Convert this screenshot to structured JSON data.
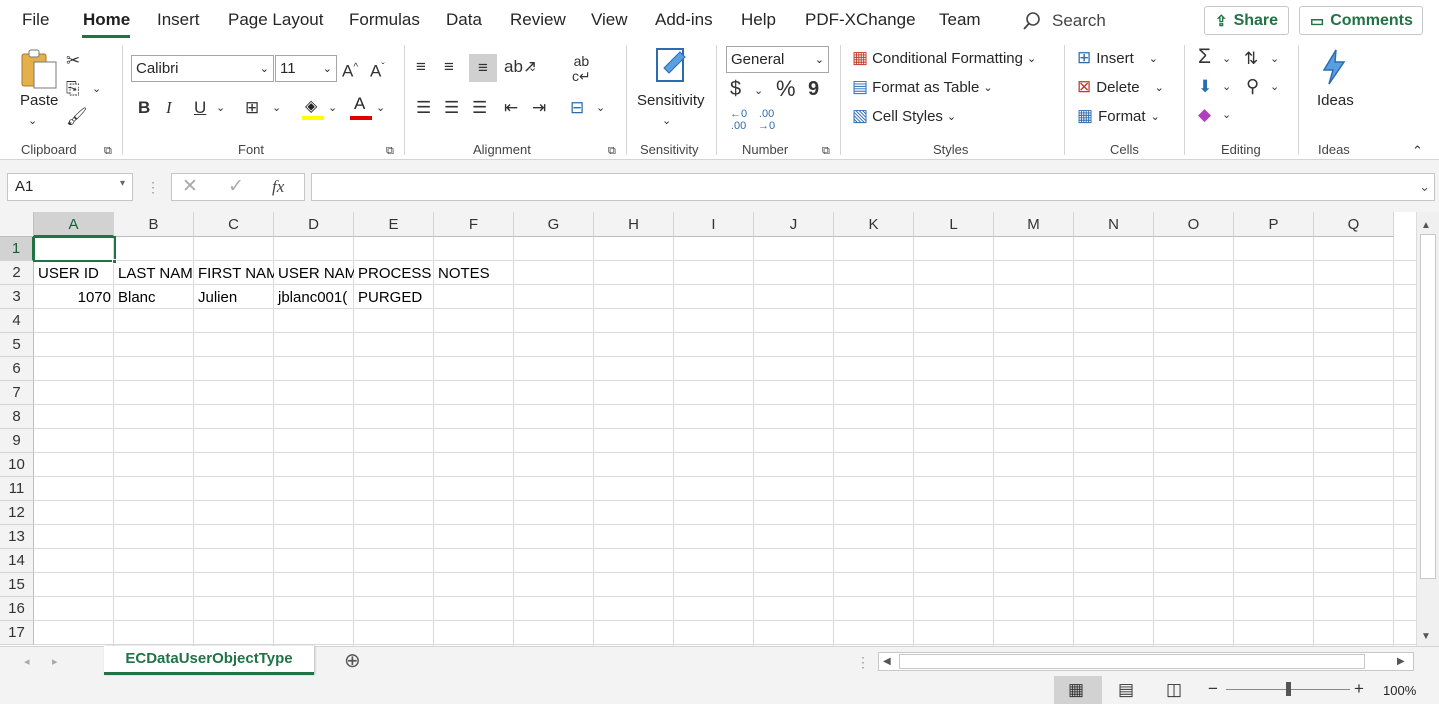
{
  "menu": {
    "tabs": [
      "File",
      "Home",
      "Insert",
      "Page Layout",
      "Formulas",
      "Data",
      "Review",
      "View",
      "Add-ins",
      "Help",
      "PDF-XChange",
      "Team"
    ],
    "search": "Search",
    "share": "Share",
    "comments": "Comments"
  },
  "ribbon": {
    "clipboard": {
      "paste": "Paste",
      "label": "Clipboard"
    },
    "font": {
      "name": "Calibri",
      "size": "11",
      "label": "Font",
      "bold": "B",
      "italic": "I",
      "underline": "U"
    },
    "alignment": {
      "label": "Alignment"
    },
    "sensitivity": {
      "button": "Sensitivity",
      "label": "Sensitivity"
    },
    "number": {
      "format": "General",
      "currency": "$",
      "percent": "%",
      "comma": "9",
      "label": "Number"
    },
    "styles": {
      "conditional": "Conditional Formatting",
      "table": "Format as Table",
      "cell_styles": "Cell Styles",
      "label": "Styles"
    },
    "cells": {
      "insert": "Insert",
      "delete": "Delete",
      "format": "Format",
      "label": "Cells"
    },
    "editing": {
      "label": "Editing"
    },
    "ideas": {
      "button": "Ideas",
      "label": "Ideas"
    }
  },
  "formula_bar": {
    "name_box": "A1",
    "fx": "fx",
    "content": ""
  },
  "sheet": {
    "columns": [
      "A",
      "B",
      "C",
      "D",
      "E",
      "F",
      "G",
      "H",
      "I",
      "J",
      "K",
      "L",
      "M",
      "N",
      "O",
      "P",
      "Q"
    ],
    "rows": [
      "1",
      "2",
      "3",
      "4",
      "5",
      "6",
      "7",
      "8",
      "9",
      "10",
      "11",
      "12",
      "13",
      "14",
      "15",
      "16",
      "17"
    ],
    "headers": [
      "USER ID",
      "LAST NAM",
      "FIRST NAM",
      "USER NAM",
      "PROCESS S",
      "NOTES"
    ],
    "data_row": {
      "user_id": "1070",
      "last_name": "Blanc",
      "first_name": "Julien",
      "user_name": "jblanc001(",
      "process": "PURGED"
    }
  },
  "sheet_tab": "ECDataUserObjectType",
  "status": {
    "zoom": "100%"
  },
  "colors": {
    "accent": "#217346"
  }
}
